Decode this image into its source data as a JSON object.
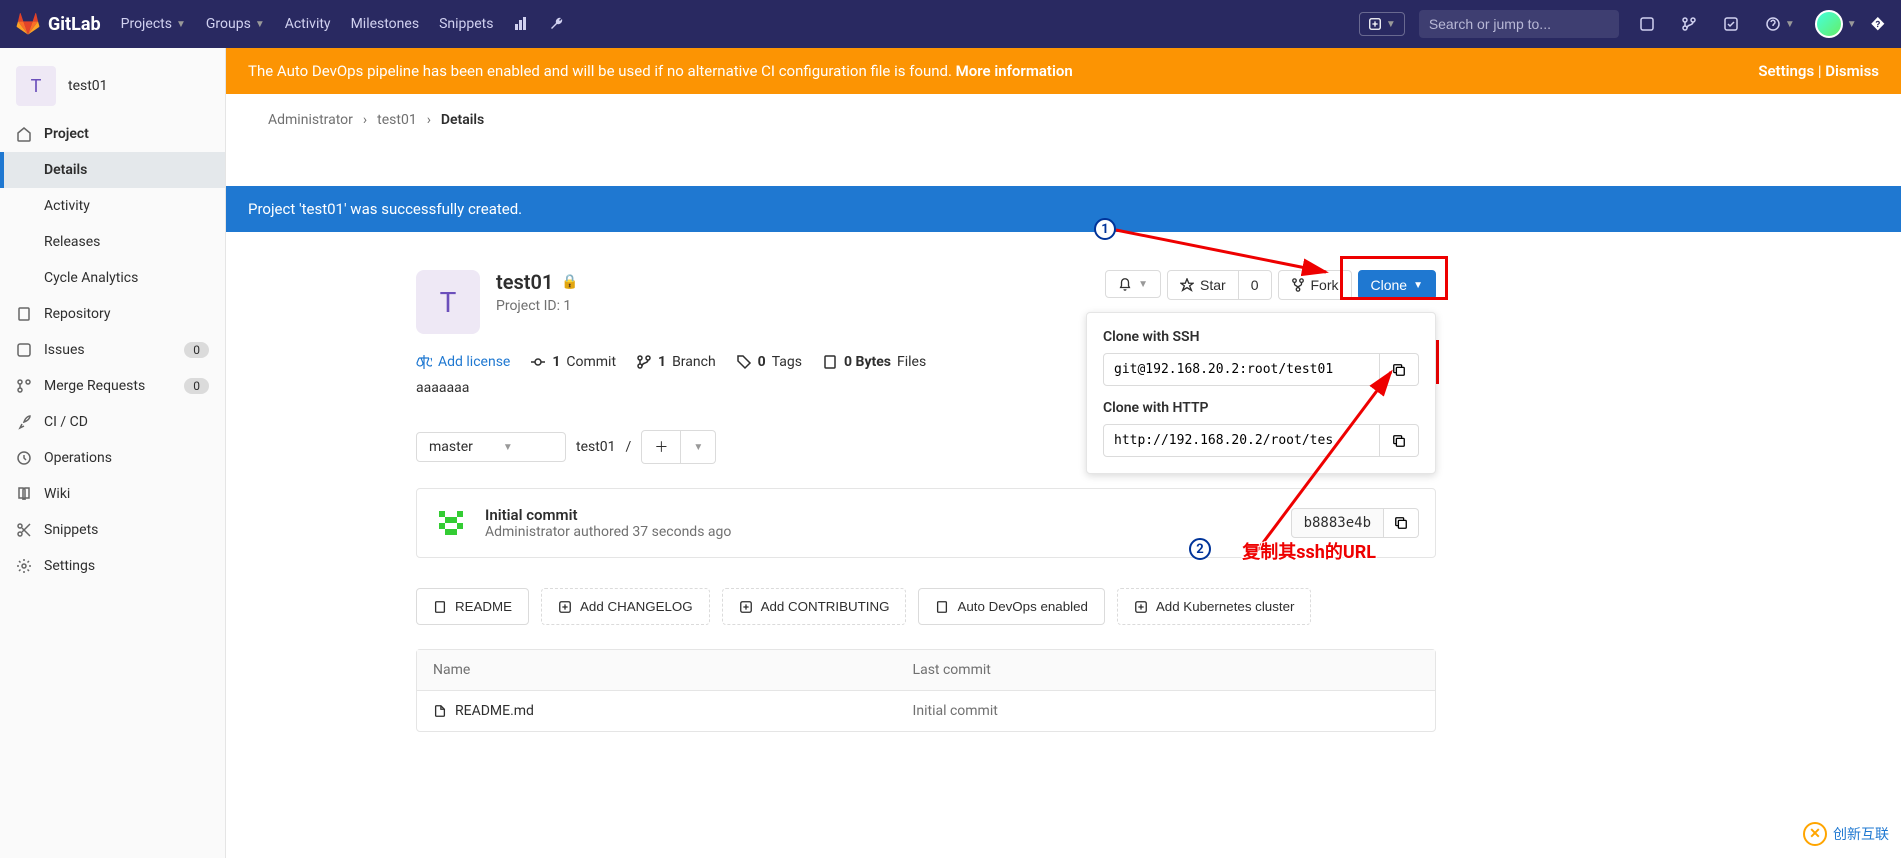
{
  "brand": "GitLab",
  "nav": {
    "projects": "Projects",
    "groups": "Groups",
    "activity": "Activity",
    "milestones": "Milestones",
    "snippets": "Snippets"
  },
  "search_placeholder": "Search or jump to...",
  "sidebar": {
    "project_letter": "T",
    "project_name": "test01",
    "items": {
      "project": "Project",
      "details": "Details",
      "activity": "Activity",
      "releases": "Releases",
      "cycle": "Cycle Analytics",
      "repository": "Repository",
      "issues": "Issues",
      "issues_count": "0",
      "merge": "Merge Requests",
      "merge_count": "0",
      "cicd": "CI / CD",
      "operations": "Operations",
      "wiki": "Wiki",
      "snippets": "Snippets",
      "settings": "Settings"
    }
  },
  "alerts": {
    "devops": "The Auto DevOps pipeline has been enabled and will be used if no alternative CI configuration file is found. ",
    "more_info": "More information",
    "settings": "Settings",
    "dismiss": "Dismiss",
    "success": "Project 'test01' was successfully created."
  },
  "breadcrumb": {
    "admin": "Administrator",
    "project": "test01",
    "page": "Details"
  },
  "project": {
    "avatar_letter": "T",
    "name": "test01",
    "id_label": "Project ID: 1",
    "description": "aaaaaaa"
  },
  "actions": {
    "star": "Star",
    "star_count": "0",
    "fork": "Fork",
    "clone": "Clone"
  },
  "stats": {
    "license": "Add license",
    "commits_n": "1",
    "commits": "Commit",
    "branches_n": "1",
    "branches": "Branch",
    "tags_n": "0",
    "tags": "Tags",
    "bytes_n": "0 Bytes",
    "bytes": "Files"
  },
  "branch": {
    "name": "master",
    "path": "test01",
    "sep": "/"
  },
  "commit": {
    "title": "Initial commit",
    "meta": "Administrator authored 37 seconds ago",
    "sha": "b8883e4b"
  },
  "templates": {
    "readme": "README",
    "changelog": "Add CHANGELOG",
    "contributing": "Add CONTRIBUTING",
    "devops": "Auto DevOps enabled",
    "k8s": "Add Kubernetes cluster"
  },
  "files": {
    "col_name": "Name",
    "col_commit": "Last commit",
    "rows": [
      {
        "name": "README.md",
        "commit": "Initial commit"
      }
    ]
  },
  "clone": {
    "ssh_label": "Clone with SSH",
    "ssh_url": "git@192.168.20.2:root/test01",
    "http_label": "Clone with HTTP",
    "http_url": "http://192.168.20.2/root/tes"
  },
  "annotations": {
    "note2": "复制其ssh的URL"
  },
  "watermark": "创新互联"
}
